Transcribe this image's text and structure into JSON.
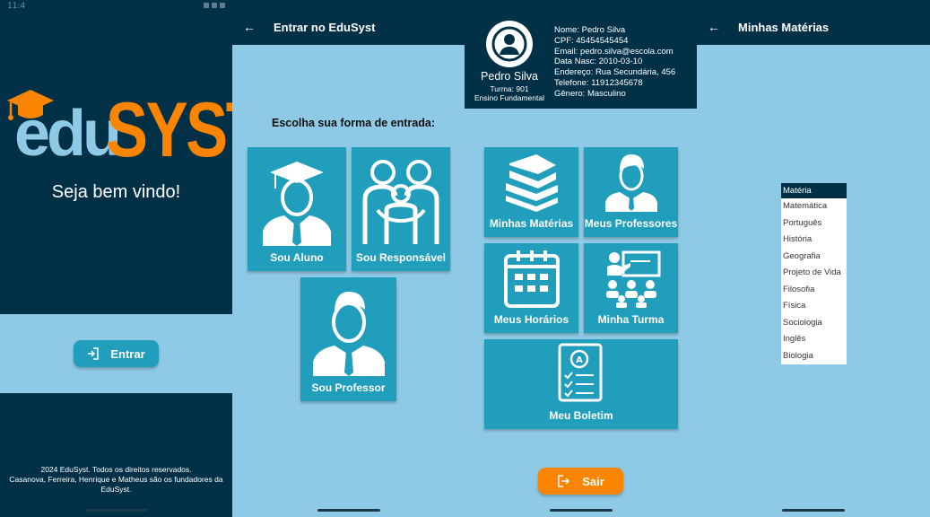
{
  "status": {
    "time": "11:4"
  },
  "welcome": {
    "logo_edu": "edu",
    "logo_syst": "SYST",
    "greeting": "Seja bem vindo!",
    "enter_button": "Entrar",
    "footer_line1": "2024 EduSyst. Todos os direitos reservados.",
    "footer_line2": "Casanova, Ferreira, Henrique e Matheus são os fundadores da EduSyst."
  },
  "login": {
    "title": "Entrar no EduSyst",
    "prompt": "Escolha sua forma de entrada:",
    "options": [
      "Sou Aluno",
      "Sou Responsável",
      "Sou Professor"
    ]
  },
  "dashboard": {
    "profile": {
      "name": "Pedro Silva",
      "class": "Turma: 901",
      "level": "Ensino Fundamental",
      "info": [
        "Nome: Pedro Silva",
        "CPF: 45454545454",
        "Email: pedro.silva@escola.com",
        "Data Nasc: 2010-03-10",
        "Endereço: Rua Secundária, 456",
        "Telefone: 11912345678",
        "Gênero: Masculino"
      ]
    },
    "tiles": [
      "Minhas Matérias",
      "Meus Professores",
      "Meus Horários",
      "Minha Turma",
      "Meu Boletim"
    ],
    "logout_button": "Sair"
  },
  "subjects": {
    "title": "Minhas Matérias",
    "header": "Matéria",
    "items": [
      "Matemática",
      "Português",
      "História",
      "Geografia",
      "Projeto de Vida",
      "Filosofia",
      "Física",
      "Sociologia",
      "Inglês",
      "Biologia"
    ]
  },
  "colors": {
    "dark": "#023047",
    "light": "#8ecae6",
    "tile": "#219ebc",
    "orange": "#fb8500"
  }
}
